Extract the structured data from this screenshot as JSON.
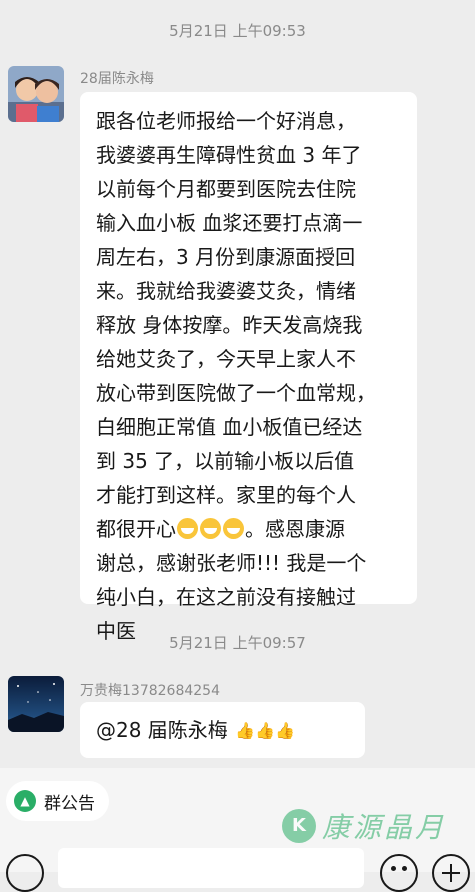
{
  "messages": [
    {
      "timestamp": "5月21日 上午09:53",
      "sender": "28届陈永梅",
      "avatar_icon": "two-children-photo-avatar",
      "lines": [
        "跟各位老师报给一个好消息，",
        "我婆婆再生障碍性贫血 3 年了",
        "以前每个月都要到医院去住院",
        "输入血小板 血浆还要打点滴一",
        "周左右，3 月份到康源面授回",
        "来。我就给我婆婆艾灸，情绪",
        "释放 身体按摩。昨天发高烧我",
        "给她艾灸了，今天早上家人不",
        "放心带到医院做了一个血常规，",
        "白细胞正常值 血小板值已经达",
        "到 35 了，以前输小板以后值",
        "才能打到这样。家里的每个人",
        "都很开心",
        "谢总，感谢张老师!!!  我是一个",
        "纯小白，在这之前没有接触过",
        "中医"
      ],
      "line13_tail": "。感恩康源",
      "emoji_icon": "grinning-face-emoji"
    },
    {
      "timestamp": "5月21日 上午09:57",
      "sender": "万贵梅13782684254",
      "avatar_icon": "night-sky-photo-avatar",
      "text": "@28 届陈永梅",
      "emoji_icon": "thumbs-up-emoji",
      "thumbs": "👍👍👍"
    }
  ],
  "toolbar": {
    "notice_label": "群公告",
    "notice_icon": "announcement-icon",
    "voice_icon": "voice-icon",
    "emoji_icon": "smiley-icon",
    "plus_icon": "plus-icon"
  },
  "watermark": {
    "text": "康源晶月",
    "logo_letter": "K"
  },
  "colors": {
    "background": "#ededed",
    "bubble": "#ffffff",
    "brand_green": "#2aae67"
  }
}
